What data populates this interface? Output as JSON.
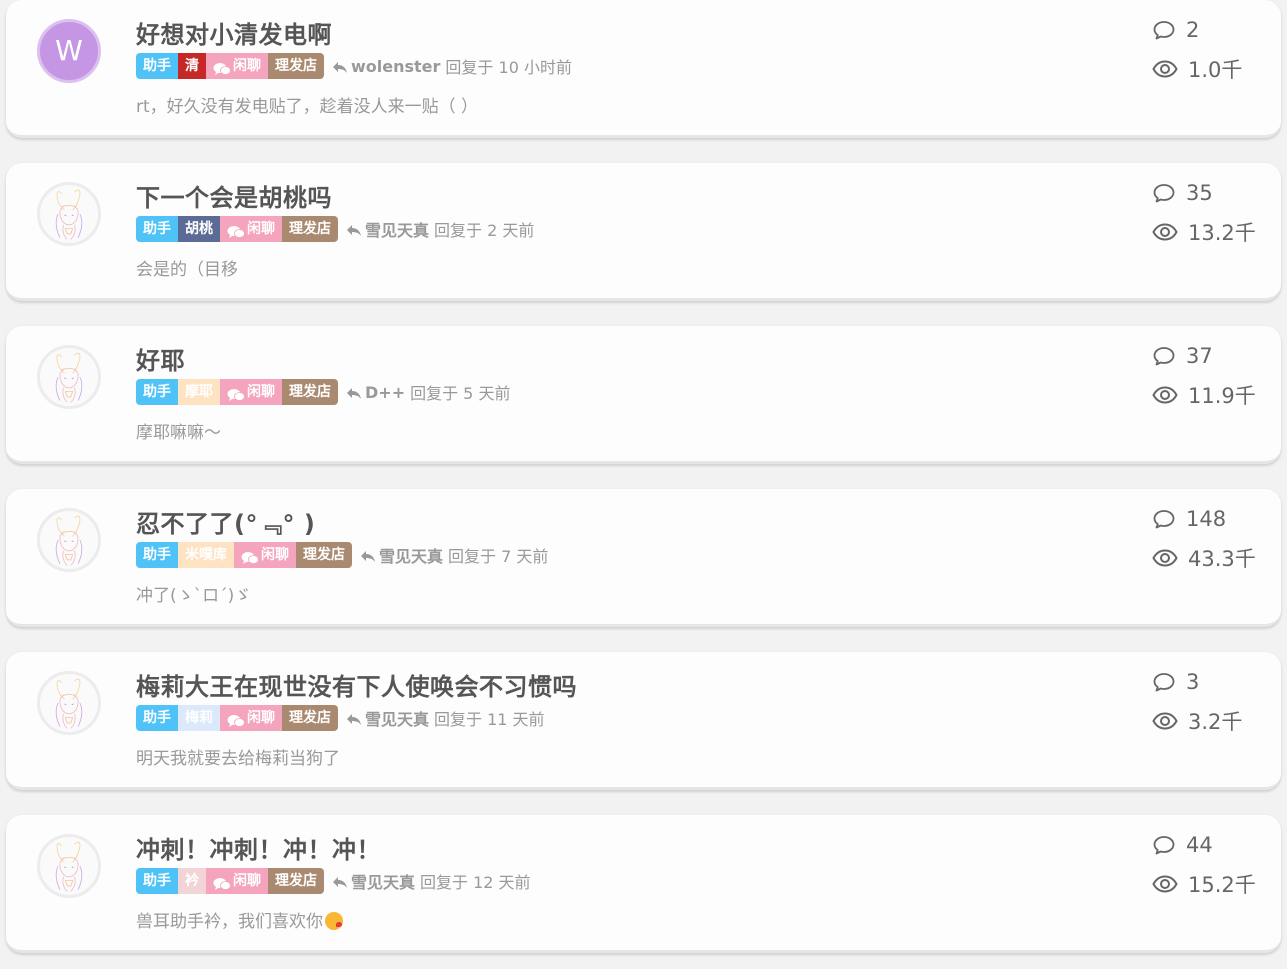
{
  "colors": {
    "tag_helper": "#4fc3f7",
    "tag_chat": "#f4a4bd",
    "tag_barber": "#a98a70"
  },
  "threads": [
    {
      "title": "好想对小清发电啊",
      "avatar": {
        "type": "letter",
        "letter": "W"
      },
      "tags": [
        {
          "label": "助手",
          "color": "#4fc3f7",
          "text_color": "#ffffff"
        },
        {
          "label": "清",
          "color": "#c62828",
          "text_color": "#ffffff"
        },
        {
          "label": "闲聊",
          "color": "#f4a4bd",
          "text_color": "#ffffff",
          "icon": "chat-bubbles-icon"
        },
        {
          "label": "理发店",
          "color": "#a98a70",
          "text_color": "#ffffff"
        }
      ],
      "reply_user": "wolenster",
      "reply_time": "回复于 10 小时前",
      "excerpt": "rt，好久没有发电贴了，趁着没人来一贴（ ）",
      "replies": "2",
      "views": "1.0千"
    },
    {
      "title": "下一个会是胡桃吗",
      "avatar": {
        "type": "image",
        "icon": "bunny-girl-avatar"
      },
      "tags": [
        {
          "label": "助手",
          "color": "#4fc3f7",
          "text_color": "#ffffff"
        },
        {
          "label": "胡桃",
          "color": "#5c6b96",
          "text_color": "#ffffff"
        },
        {
          "label": "闲聊",
          "color": "#f4a4bd",
          "text_color": "#ffffff",
          "icon": "chat-bubbles-icon"
        },
        {
          "label": "理发店",
          "color": "#a98a70",
          "text_color": "#ffffff"
        }
      ],
      "reply_user": "雪见天真",
      "reply_time": "回复于 2 天前",
      "excerpt": "会是的（目移",
      "replies": "35",
      "views": "13.2千"
    },
    {
      "title": "好耶",
      "avatar": {
        "type": "image",
        "icon": "bunny-girl-avatar"
      },
      "tags": [
        {
          "label": "助手",
          "color": "#4fc3f7",
          "text_color": "#ffffff"
        },
        {
          "label": "摩耶",
          "color": "#fde3c2",
          "text_color": "#ffffff"
        },
        {
          "label": "闲聊",
          "color": "#f4a4bd",
          "text_color": "#ffffff",
          "icon": "chat-bubbles-icon"
        },
        {
          "label": "理发店",
          "color": "#a98a70",
          "text_color": "#ffffff"
        }
      ],
      "reply_user": "D++",
      "reply_time": "回复于 5 天前",
      "excerpt": "摩耶嘛嘛～",
      "replies": "37",
      "views": "11.9千"
    },
    {
      "title": "忍不了了(°﹃° )",
      "avatar": {
        "type": "image",
        "icon": "bunny-girl-avatar"
      },
      "tags": [
        {
          "label": "助手",
          "color": "#4fc3f7",
          "text_color": "#ffffff"
        },
        {
          "label": "米噗库",
          "color": "#fde3c2",
          "text_color": "#ffffff"
        },
        {
          "label": "闲聊",
          "color": "#f4a4bd",
          "text_color": "#ffffff",
          "icon": "chat-bubbles-icon"
        },
        {
          "label": "理发店",
          "color": "#a98a70",
          "text_color": "#ffffff"
        }
      ],
      "reply_user": "雪见天真",
      "reply_time": "回复于 7 天前",
      "excerpt": "冲了(ゝ`ロ´)ゞ",
      "replies": "148",
      "views": "43.3千"
    },
    {
      "title": "梅莉大王在现世没有下人使唤会不习惯吗",
      "avatar": {
        "type": "image",
        "icon": "bunny-girl-avatar"
      },
      "tags": [
        {
          "label": "助手",
          "color": "#4fc3f7",
          "text_color": "#ffffff"
        },
        {
          "label": "梅莉",
          "color": "#dbe9fa",
          "text_color": "#ffffff"
        },
        {
          "label": "闲聊",
          "color": "#f4a4bd",
          "text_color": "#ffffff",
          "icon": "chat-bubbles-icon"
        },
        {
          "label": "理发店",
          "color": "#a98a70",
          "text_color": "#ffffff"
        }
      ],
      "reply_user": "雪见天真",
      "reply_time": "回复于 11 天前",
      "excerpt": "明天我就要去给梅莉当狗了",
      "replies": "3",
      "views": "3.2千"
    },
    {
      "title": "冲刺！冲刺！冲！冲！",
      "avatar": {
        "type": "image",
        "icon": "bunny-girl-avatar"
      },
      "tags": [
        {
          "label": "助手",
          "color": "#4fc3f7",
          "text_color": "#ffffff"
        },
        {
          "label": "衿",
          "color": "#f2d4d6",
          "text_color": "#ffffff"
        },
        {
          "label": "闲聊",
          "color": "#f4a4bd",
          "text_color": "#ffffff",
          "icon": "chat-bubbles-icon"
        },
        {
          "label": "理发店",
          "color": "#a98a70",
          "text_color": "#ffffff"
        }
      ],
      "reply_user": "雪见天真",
      "reply_time": "回复于 12 天前",
      "excerpt": "兽耳助手衿，我们喜欢你",
      "excerpt_emoji": "kiss-face-emoji",
      "replies": "44",
      "views": "15.2千"
    }
  ]
}
